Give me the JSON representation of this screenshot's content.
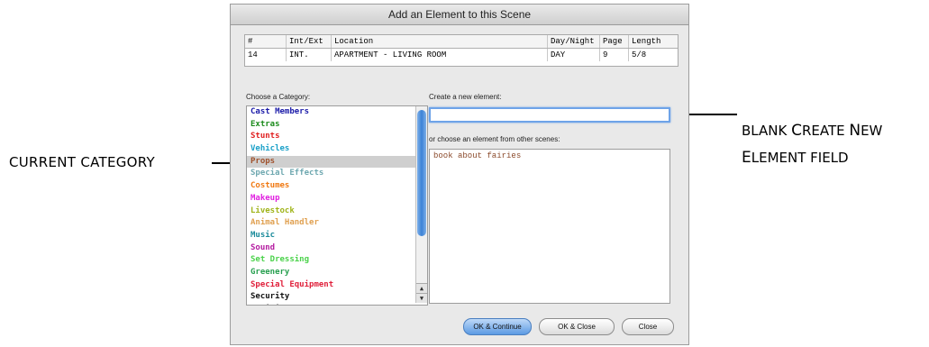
{
  "annotations": {
    "current_category": "CURRENT CATEGORY",
    "blank_field_line1_a": "BLANK ",
    "blank_field_line1_b": "C",
    "blank_field_line1_c": "REATE ",
    "blank_field_line1_d": "N",
    "blank_field_line1_e": "EW",
    "blank_field_line2_a": "E",
    "blank_field_line2_b": "LEMENT FIELD"
  },
  "window": {
    "title": "Add an Element to this Scene"
  },
  "scene_table": {
    "headers": [
      "#",
      "Int/Ext",
      "Location",
      "Day/Night",
      "Page",
      "Length"
    ],
    "row": [
      "14",
      "INT.",
      "APARTMENT - LIVING ROOM",
      "DAY",
      "9",
      "5/8"
    ]
  },
  "category_label": "Choose a Category:",
  "categories": [
    {
      "label": "Cast Members",
      "color": "#1a1aa8"
    },
    {
      "label": "Extras",
      "color": "#1a8a1a"
    },
    {
      "label": "Stunts",
      "color": "#e01f1f"
    },
    {
      "label": "Vehicles",
      "color": "#1aa0c8"
    },
    {
      "label": "Props",
      "color": "#a0522d"
    },
    {
      "label": "Special Effects",
      "color": "#6fa8b0"
    },
    {
      "label": "Costumes",
      "color": "#f07a14"
    },
    {
      "label": "Makeup",
      "color": "#e01fe0"
    },
    {
      "label": "Livestock",
      "color": "#a0b41a"
    },
    {
      "label": "Animal Handler",
      "color": "#e0a050"
    },
    {
      "label": "Music",
      "color": "#1a8a9a"
    },
    {
      "label": "Sound",
      "color": "#b41aa0"
    },
    {
      "label": "Set Dressing",
      "color": "#4ad24a"
    },
    {
      "label": "Greenery",
      "color": "#28a050"
    },
    {
      "label": "Special Equipment",
      "color": "#e01f3a"
    },
    {
      "label": "Security",
      "color": "#111111"
    },
    {
      "label": "Additional Labor",
      "color": "#111111"
    }
  ],
  "selected_category": "Props",
  "new_element": {
    "label": "Create a new element:",
    "value": ""
  },
  "other_scenes": {
    "label": "or choose an element from other scenes:",
    "items": [
      "book about fairies"
    ]
  },
  "buttons": {
    "ok_continue": "OK & Continue",
    "ok_close": "OK & Close",
    "close": "Close"
  },
  "icons": {
    "scroll_up": "▲",
    "scroll_down": "▼"
  }
}
